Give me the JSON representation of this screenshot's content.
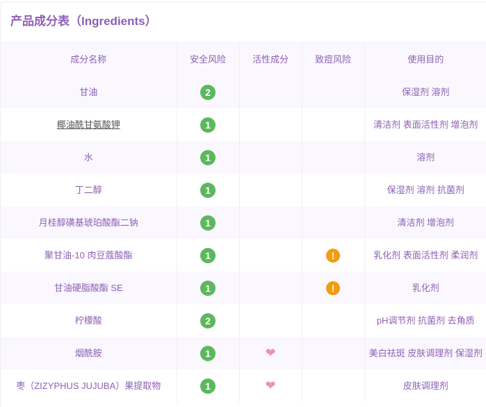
{
  "title": "产品成分表（Ingredients）",
  "headers": [
    "成分名称",
    "安全风险",
    "活性成分",
    "致痘风险",
    "使用目的"
  ],
  "rows": [
    {
      "name": "甘油",
      "safety": "2",
      "active": false,
      "acne": false,
      "purpose": "保湿剂 溶剂"
    },
    {
      "name": "椰油酰甘氨酸钾",
      "safety": "1",
      "active": false,
      "acne": false,
      "purpose": "清洁剂 表面活性剂 增泡剂",
      "link": true
    },
    {
      "name": "水",
      "safety": "1",
      "active": false,
      "acne": false,
      "purpose": "溶剂"
    },
    {
      "name": "丁二醇",
      "safety": "1",
      "active": false,
      "acne": false,
      "purpose": "保湿剂 溶剂 抗菌剂"
    },
    {
      "name": "月桂醇磺基琥珀酸酯二钠",
      "safety": "1",
      "active": false,
      "acne": false,
      "purpose": "清洁剂 增泡剂"
    },
    {
      "name": "聚甘油-10 肉豆蔻酸酯",
      "safety": "1",
      "active": false,
      "acne": true,
      "purpose": "乳化剂 表面活性剂 柔润剂"
    },
    {
      "name": "甘油硬脂酸酯 SE",
      "safety": "1",
      "active": false,
      "acne": true,
      "purpose": "乳化剂"
    },
    {
      "name": "柠檬酸",
      "safety": "2",
      "active": false,
      "acne": false,
      "purpose": "pH调节剂 抗菌剂 去角质"
    },
    {
      "name": "烟酰胺",
      "safety": "1",
      "active": true,
      "acne": false,
      "purpose": "美白祛斑 皮肤调理剂 保湿剂"
    },
    {
      "name": "枣（ZIZYPHUS JUJUBA）果提取物",
      "safety": "1",
      "active": true,
      "acne": false,
      "purpose": "皮肤调理剂"
    }
  ],
  "icons": {
    "active": "heart-icon",
    "acne": "exclamation-icon"
  },
  "colors": {
    "text": "#8e5fb5",
    "safe": "#5cb85c",
    "warn": "#f39c12",
    "heart": "#ee8fbf"
  }
}
